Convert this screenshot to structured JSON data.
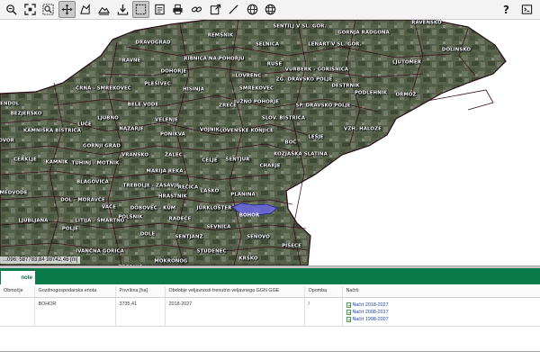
{
  "toolbar": {
    "left_icons": [
      "zoom-out-icon",
      "zoom-extent-icon",
      "zoom-window-icon",
      "pan-icon",
      "measure-area-icon",
      "print-preview-icon",
      "download-icon",
      "select-icon",
      "info-icon",
      "print-icon",
      "link-icon",
      "export-icon",
      "draw-line-icon",
      "globe-icon",
      "globe-alt-icon"
    ],
    "active_icon": "select-icon",
    "help_label": "?"
  },
  "map": {
    "coordinate_readout": "...096: 587783,84 98742,46 [m]",
    "selected_unit": "BOHOR",
    "labels": [
      [
        "ŠENTILJ V SL. GOR.",
        333,
        4
      ],
      [
        "GORNJA RADGONA",
        404,
        11
      ],
      [
        "RAVENSKO",
        474,
        0
      ],
      [
        "REMŠNIK",
        245,
        14
      ],
      [
        "DRAVOGRAD",
        170,
        22
      ],
      [
        "SELNICA",
        297,
        24
      ],
      [
        "LENART V SL. GOR.",
        372,
        24
      ],
      [
        "DOLINSKO",
        507,
        30
      ],
      [
        "RAVNE",
        146,
        42
      ],
      [
        "RIBNICA NA POHORJU",
        238,
        40
      ],
      [
        "RUŠE",
        305,
        46
      ],
      [
        "LJUTOMER",
        452,
        44
      ],
      [
        "DOHORJE",
        193,
        54
      ],
      [
        "VURBERK - GORIŠNICA",
        352,
        52
      ],
      [
        "ČRNA - SMREKOVEC",
        115,
        73
      ],
      [
        "PLEŠIVEC",
        175,
        68
      ],
      [
        "LOVRENC",
        276,
        59
      ],
      [
        "ZG. DRAVSKO POLJE",
        338,
        63
      ],
      [
        "HISINJA",
        215,
        74
      ],
      [
        "SMREKOVEC",
        285,
        73
      ],
      [
        "DESTRNIK",
        384,
        70
      ],
      [
        "PODLEHNIK",
        412,
        78
      ],
      [
        "ORMOŽ",
        451,
        80
      ],
      [
        "LENDOL",
        9,
        90
      ],
      [
        "JUŽNO POHORJE",
        285,
        88
      ],
      [
        "SP. DRAVSKO POLJE",
        359,
        92
      ],
      [
        "BEZJERSKO",
        29,
        101
      ],
      [
        "BELE VODE",
        159,
        91
      ],
      [
        "ZREČE",
        253,
        92
      ],
      [
        "LJUBNO",
        120,
        106
      ],
      [
        "VELENJE",
        185,
        108
      ],
      [
        "SLOV. BISTRICA",
        315,
        106
      ],
      [
        "KAMNIŠKA BISTRICA",
        58,
        120
      ],
      [
        "LUČE",
        94,
        113
      ],
      [
        "NAZARJE",
        146,
        118
      ],
      [
        "SLOVENSKE KONJICE",
        272,
        120
      ],
      [
        "VZH. HALOZE",
        403,
        118
      ],
      [
        "PONIKVA",
        192,
        124
      ],
      [
        "VOJNIK",
        233,
        119
      ],
      [
        "VOVOR",
        5,
        131
      ],
      [
        "BOČ",
        323,
        133
      ],
      [
        "LEŠJE",
        351,
        127
      ],
      [
        "GORNJI GRAD",
        113,
        137
      ],
      [
        "ŽALEC",
        193,
        147
      ],
      [
        "KOZJAŠKA SLATINA",
        334,
        146
      ],
      [
        "VRANSKO",
        150,
        147
      ],
      [
        "CERKLJE",
        28,
        152
      ],
      [
        "KAMNIK",
        63,
        155
      ],
      [
        "TUHINJ - MOTNIK",
        106,
        156
      ],
      [
        "CELJE",
        233,
        153
      ],
      [
        "ŠENTJUR",
        264,
        152
      ],
      [
        "CHARJE",
        300,
        159
      ],
      [
        "MARIJA REKA",
        183,
        165
      ],
      [
        "TREBOLJE - ZASAVJE",
        168,
        181
      ],
      [
        "BLAGOVICA",
        103,
        177
      ],
      [
        "REČICA",
        209,
        183
      ],
      [
        "LAŠKO",
        233,
        187
      ],
      [
        "MEDVODE",
        15,
        189
      ],
      [
        "DOL - MORAVČE",
        92,
        197
      ],
      [
        "HRASTNIK",
        192,
        193
      ],
      [
        "PLANINA",
        270,
        191
      ],
      [
        "VAČE",
        121,
        205
      ],
      [
        "DOBOVEC - KUM",
        170,
        206
      ],
      [
        "JURKLOŠTER",
        238,
        206
      ],
      [
        "LJUBLJANA",
        37,
        220
      ],
      [
        "LITIJA - ŠMARTNO",
        111,
        220
      ],
      [
        "POLŠNIK",
        145,
        216
      ],
      [
        "RADEČE",
        200,
        218
      ],
      [
        "POLJE",
        78,
        229
      ],
      [
        "SEVNICA",
        243,
        227
      ],
      [
        "BOHOR",
        277,
        214
      ],
      [
        "DOLE",
        164,
        235
      ],
      [
        "SENTJANŽ",
        210,
        238
      ],
      [
        "SENOVO",
        287,
        238
      ],
      [
        "STUDENEC",
        235,
        254
      ],
      [
        "PIŠECE",
        324,
        248
      ],
      [
        "IVANČNA GORICA",
        111,
        254
      ],
      [
        "KRŠKO",
        276,
        262
      ],
      [
        "MOKRONOG",
        190,
        265
      ],
      [
        "TREBNJE",
        145,
        272
      ]
    ]
  },
  "panel": {
    "tab_label": "note",
    "columns": [
      "Območje",
      "Gozdnogospodarska enota",
      "Površina [ha]",
      "Obdobje veljavnosti trenutno veljavnega GGN GGE",
      "Opomba",
      "Načrti"
    ],
    "rows": [
      {
        "obmocje": "",
        "enota": "BOHOR",
        "povrsina": "3735,41",
        "obdobje": "2018-2027",
        "opomba": "/",
        "nacrti": [
          "Načrt 2018-2027",
          "Načrt 2008-2017",
          "Načrt 1998-2007"
        ]
      }
    ]
  },
  "colors": {
    "tab_green": "#0a7a4a",
    "link_blue": "#1a3ea8",
    "selected_polygon": "#6a6ae0",
    "boundary": "#3a0a1a"
  }
}
